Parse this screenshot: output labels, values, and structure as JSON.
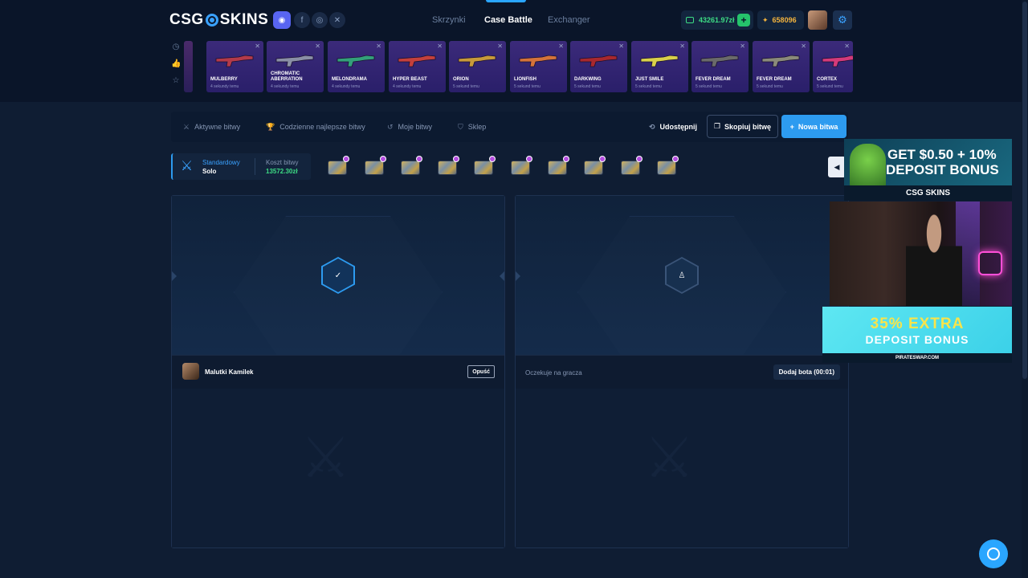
{
  "header": {
    "logo_left": "CSG",
    "logo_right": "SKINS",
    "nav": [
      {
        "label": "Skrzynki",
        "active": false
      },
      {
        "label": "Case Battle",
        "active": true
      },
      {
        "label": "Exchanger",
        "active": false
      }
    ],
    "balance": "43261.97zł",
    "coins": "658096",
    "colors": {
      "accent": "#2d9bf0",
      "balance": "#3ddc84",
      "coins": "#f2b33d"
    }
  },
  "drops": [
    {
      "name": "MULBERRY",
      "time": "4 sekundy temu",
      "color": "#b33a4a"
    },
    {
      "name": "CHROMATIC ABERRATION",
      "time": "4 sekundy temu",
      "color": "#8a8fa6"
    },
    {
      "name": "MELONDRAMA",
      "time": "4 sekundy temu",
      "color": "#33a07a"
    },
    {
      "name": "HYPER BEAST",
      "time": "4 sekundy temu",
      "color": "#c4403c"
    },
    {
      "name": "ORION",
      "time": "5 sekund temu",
      "color": "#c89a3a"
    },
    {
      "name": "LIONFISH",
      "time": "5 sekund temu",
      "color": "#d4733a"
    },
    {
      "name": "DARKWING",
      "time": "5 sekund temu",
      "color": "#a8282e"
    },
    {
      "name": "JUST SMILE",
      "time": "5 sekund temu",
      "color": "#d9d14a"
    },
    {
      "name": "FEVER DREAM",
      "time": "5 sekund temu",
      "color": "#6a6a6a"
    },
    {
      "name": "FEVER DREAM",
      "time": "5 sekund temu",
      "color": "#8a8a7a"
    },
    {
      "name": "CORTEX",
      "time": "5 sekund temu",
      "color": "#d43a7a"
    }
  ],
  "subnav": {
    "active_battles": "Aktywne bitwy",
    "daily_best": "Codzienne najlepsze bitwy",
    "my_battles": "Moje bitwy",
    "shop": "Sklep",
    "share": "Udostępnij",
    "copy": "Skopiuj bitwę",
    "new": "Nowa bitwa"
  },
  "battle": {
    "mode_label": "Standardowy",
    "mode_value": "Solo",
    "cost_label": "Koszt bitwy",
    "cost_value": "13572.30zł",
    "case_count": 10
  },
  "players": [
    {
      "name": "Malutki Kamilek",
      "action": "Opuść",
      "icon": "check-icon"
    },
    {
      "waiting": "Oczekuje na gracza",
      "action": "Dodaj bota (00:01)",
      "icon": "user-icon"
    }
  ],
  "ads": {
    "top_line1": "GET $0.50 + 10%",
    "top_line2": "DEPOSIT BONUS",
    "top_brand": "CSG SKINS",
    "bottom_line1": "35% EXTRA",
    "bottom_line2": "DEPOSIT BONUS",
    "bottom_url": "PIRATESWAP.COM"
  }
}
